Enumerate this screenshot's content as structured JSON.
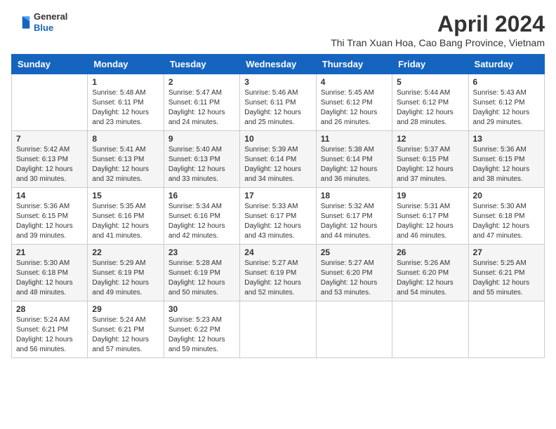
{
  "header": {
    "logo": {
      "general": "General",
      "blue": "Blue"
    },
    "title": "April 2024",
    "subtitle": "Thi Tran Xuan Hoa, Cao Bang Province, Vietnam"
  },
  "weekdays": [
    "Sunday",
    "Monday",
    "Tuesday",
    "Wednesday",
    "Thursday",
    "Friday",
    "Saturday"
  ],
  "weeks": [
    [
      {
        "day": "",
        "sunrise": "",
        "sunset": "",
        "daylight": ""
      },
      {
        "day": "1",
        "sunrise": "Sunrise: 5:48 AM",
        "sunset": "Sunset: 6:11 PM",
        "daylight": "Daylight: 12 hours and 23 minutes."
      },
      {
        "day": "2",
        "sunrise": "Sunrise: 5:47 AM",
        "sunset": "Sunset: 6:11 PM",
        "daylight": "Daylight: 12 hours and 24 minutes."
      },
      {
        "day": "3",
        "sunrise": "Sunrise: 5:46 AM",
        "sunset": "Sunset: 6:11 PM",
        "daylight": "Daylight: 12 hours and 25 minutes."
      },
      {
        "day": "4",
        "sunrise": "Sunrise: 5:45 AM",
        "sunset": "Sunset: 6:12 PM",
        "daylight": "Daylight: 12 hours and 26 minutes."
      },
      {
        "day": "5",
        "sunrise": "Sunrise: 5:44 AM",
        "sunset": "Sunset: 6:12 PM",
        "daylight": "Daylight: 12 hours and 28 minutes."
      },
      {
        "day": "6",
        "sunrise": "Sunrise: 5:43 AM",
        "sunset": "Sunset: 6:12 PM",
        "daylight": "Daylight: 12 hours and 29 minutes."
      }
    ],
    [
      {
        "day": "7",
        "sunrise": "Sunrise: 5:42 AM",
        "sunset": "Sunset: 6:13 PM",
        "daylight": "Daylight: 12 hours and 30 minutes."
      },
      {
        "day": "8",
        "sunrise": "Sunrise: 5:41 AM",
        "sunset": "Sunset: 6:13 PM",
        "daylight": "Daylight: 12 hours and 32 minutes."
      },
      {
        "day": "9",
        "sunrise": "Sunrise: 5:40 AM",
        "sunset": "Sunset: 6:13 PM",
        "daylight": "Daylight: 12 hours and 33 minutes."
      },
      {
        "day": "10",
        "sunrise": "Sunrise: 5:39 AM",
        "sunset": "Sunset: 6:14 PM",
        "daylight": "Daylight: 12 hours and 34 minutes."
      },
      {
        "day": "11",
        "sunrise": "Sunrise: 5:38 AM",
        "sunset": "Sunset: 6:14 PM",
        "daylight": "Daylight: 12 hours and 36 minutes."
      },
      {
        "day": "12",
        "sunrise": "Sunrise: 5:37 AM",
        "sunset": "Sunset: 6:15 PM",
        "daylight": "Daylight: 12 hours and 37 minutes."
      },
      {
        "day": "13",
        "sunrise": "Sunrise: 5:36 AM",
        "sunset": "Sunset: 6:15 PM",
        "daylight": "Daylight: 12 hours and 38 minutes."
      }
    ],
    [
      {
        "day": "14",
        "sunrise": "Sunrise: 5:36 AM",
        "sunset": "Sunset: 6:15 PM",
        "daylight": "Daylight: 12 hours and 39 minutes."
      },
      {
        "day": "15",
        "sunrise": "Sunrise: 5:35 AM",
        "sunset": "Sunset: 6:16 PM",
        "daylight": "Daylight: 12 hours and 41 minutes."
      },
      {
        "day": "16",
        "sunrise": "Sunrise: 5:34 AM",
        "sunset": "Sunset: 6:16 PM",
        "daylight": "Daylight: 12 hours and 42 minutes."
      },
      {
        "day": "17",
        "sunrise": "Sunrise: 5:33 AM",
        "sunset": "Sunset: 6:17 PM",
        "daylight": "Daylight: 12 hours and 43 minutes."
      },
      {
        "day": "18",
        "sunrise": "Sunrise: 5:32 AM",
        "sunset": "Sunset: 6:17 PM",
        "daylight": "Daylight: 12 hours and 44 minutes."
      },
      {
        "day": "19",
        "sunrise": "Sunrise: 5:31 AM",
        "sunset": "Sunset: 6:17 PM",
        "daylight": "Daylight: 12 hours and 46 minutes."
      },
      {
        "day": "20",
        "sunrise": "Sunrise: 5:30 AM",
        "sunset": "Sunset: 6:18 PM",
        "daylight": "Daylight: 12 hours and 47 minutes."
      }
    ],
    [
      {
        "day": "21",
        "sunrise": "Sunrise: 5:30 AM",
        "sunset": "Sunset: 6:18 PM",
        "daylight": "Daylight: 12 hours and 48 minutes."
      },
      {
        "day": "22",
        "sunrise": "Sunrise: 5:29 AM",
        "sunset": "Sunset: 6:19 PM",
        "daylight": "Daylight: 12 hours and 49 minutes."
      },
      {
        "day": "23",
        "sunrise": "Sunrise: 5:28 AM",
        "sunset": "Sunset: 6:19 PM",
        "daylight": "Daylight: 12 hours and 50 minutes."
      },
      {
        "day": "24",
        "sunrise": "Sunrise: 5:27 AM",
        "sunset": "Sunset: 6:19 PM",
        "daylight": "Daylight: 12 hours and 52 minutes."
      },
      {
        "day": "25",
        "sunrise": "Sunrise: 5:27 AM",
        "sunset": "Sunset: 6:20 PM",
        "daylight": "Daylight: 12 hours and 53 minutes."
      },
      {
        "day": "26",
        "sunrise": "Sunrise: 5:26 AM",
        "sunset": "Sunset: 6:20 PM",
        "daylight": "Daylight: 12 hours and 54 minutes."
      },
      {
        "day": "27",
        "sunrise": "Sunrise: 5:25 AM",
        "sunset": "Sunset: 6:21 PM",
        "daylight": "Daylight: 12 hours and 55 minutes."
      }
    ],
    [
      {
        "day": "28",
        "sunrise": "Sunrise: 5:24 AM",
        "sunset": "Sunset: 6:21 PM",
        "daylight": "Daylight: 12 hours and 56 minutes."
      },
      {
        "day": "29",
        "sunrise": "Sunrise: 5:24 AM",
        "sunset": "Sunset: 6:21 PM",
        "daylight": "Daylight: 12 hours and 57 minutes."
      },
      {
        "day": "30",
        "sunrise": "Sunrise: 5:23 AM",
        "sunset": "Sunset: 6:22 PM",
        "daylight": "Daylight: 12 hours and 59 minutes."
      },
      {
        "day": "",
        "sunrise": "",
        "sunset": "",
        "daylight": ""
      },
      {
        "day": "",
        "sunrise": "",
        "sunset": "",
        "daylight": ""
      },
      {
        "day": "",
        "sunrise": "",
        "sunset": "",
        "daylight": ""
      },
      {
        "day": "",
        "sunrise": "",
        "sunset": "",
        "daylight": ""
      }
    ]
  ]
}
